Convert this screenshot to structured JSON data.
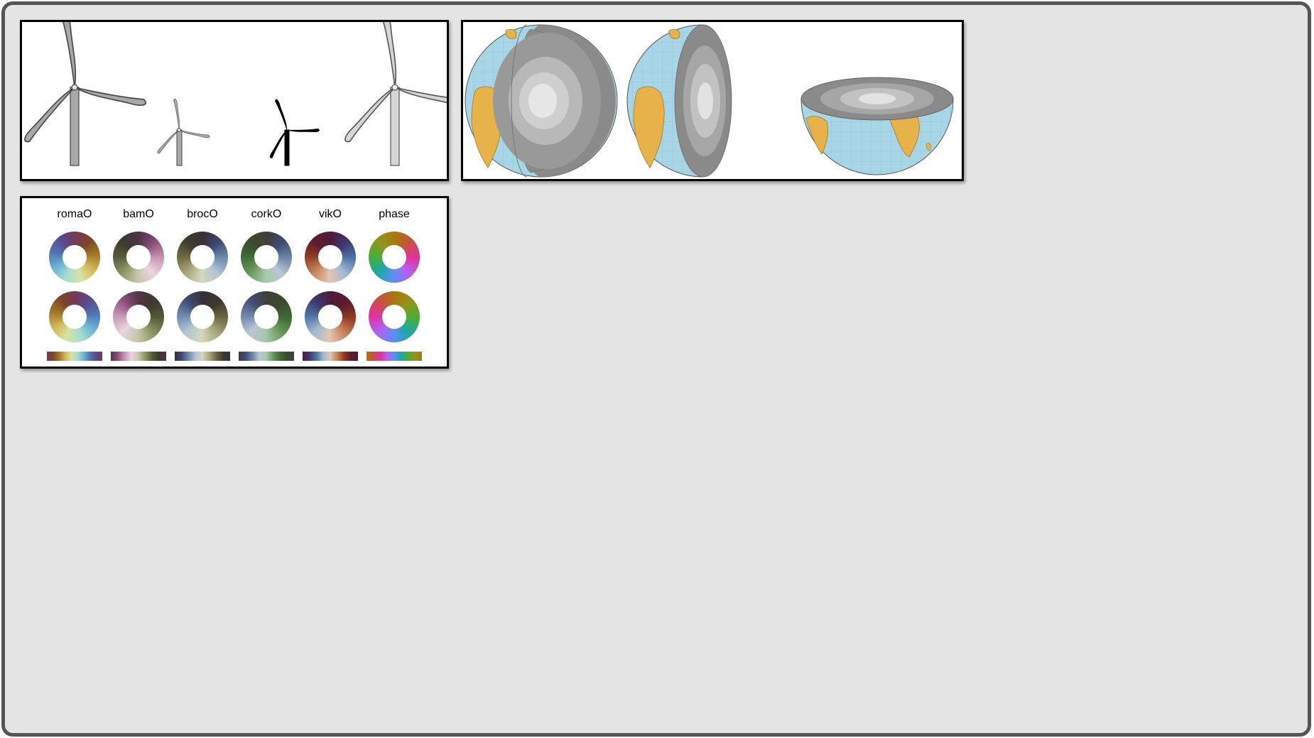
{
  "colormaps": {
    "labels": [
      "romaO",
      "bamO",
      "brocO",
      "corkO",
      "vikO",
      "phase"
    ],
    "sets": [
      {
        "name": "romaO",
        "stops": [
          "#733957",
          "#7d4527",
          "#a1772a",
          "#d1b756",
          "#d7e3a3",
          "#a6dcd1",
          "#6bb3d2",
          "#5075b2",
          "#5a4a8c",
          "#733957"
        ]
      },
      {
        "name": "bamO",
        "stops": [
          "#4f3346",
          "#8c5078",
          "#c897b4",
          "#ecd3e0",
          "#c5c8a8",
          "#8b9363",
          "#54593a",
          "#3d3a2e",
          "#4f3346"
        ]
      },
      {
        "name": "brocO",
        "stops": [
          "#372f3a",
          "#3e4a72",
          "#6f8bb0",
          "#b3c3d3",
          "#d5d8bd",
          "#a8a57a",
          "#6b6841",
          "#3e3a2d",
          "#372f3a"
        ]
      },
      {
        "name": "corkO",
        "stops": [
          "#3f3e3b",
          "#404c73",
          "#6f86ab",
          "#b8c6d6",
          "#a9c8a9",
          "#6a975e",
          "#3f6a35",
          "#3b4a2e",
          "#3f3e3b"
        ]
      },
      {
        "name": "vikO",
        "stops": [
          "#4f1a3d",
          "#3a3a6d",
          "#4d73a2",
          "#a3b9d0",
          "#e3c5b3",
          "#c68259",
          "#8e3b23",
          "#5c1a2e",
          "#4f1a3d"
        ]
      },
      {
        "name": "phase",
        "stops": [
          "#a8780d",
          "#c84f45",
          "#e0339b",
          "#b45ff0",
          "#5d8ef7",
          "#1da8a4",
          "#4bad34",
          "#92951c",
          "#a8780d"
        ]
      }
    ]
  }
}
